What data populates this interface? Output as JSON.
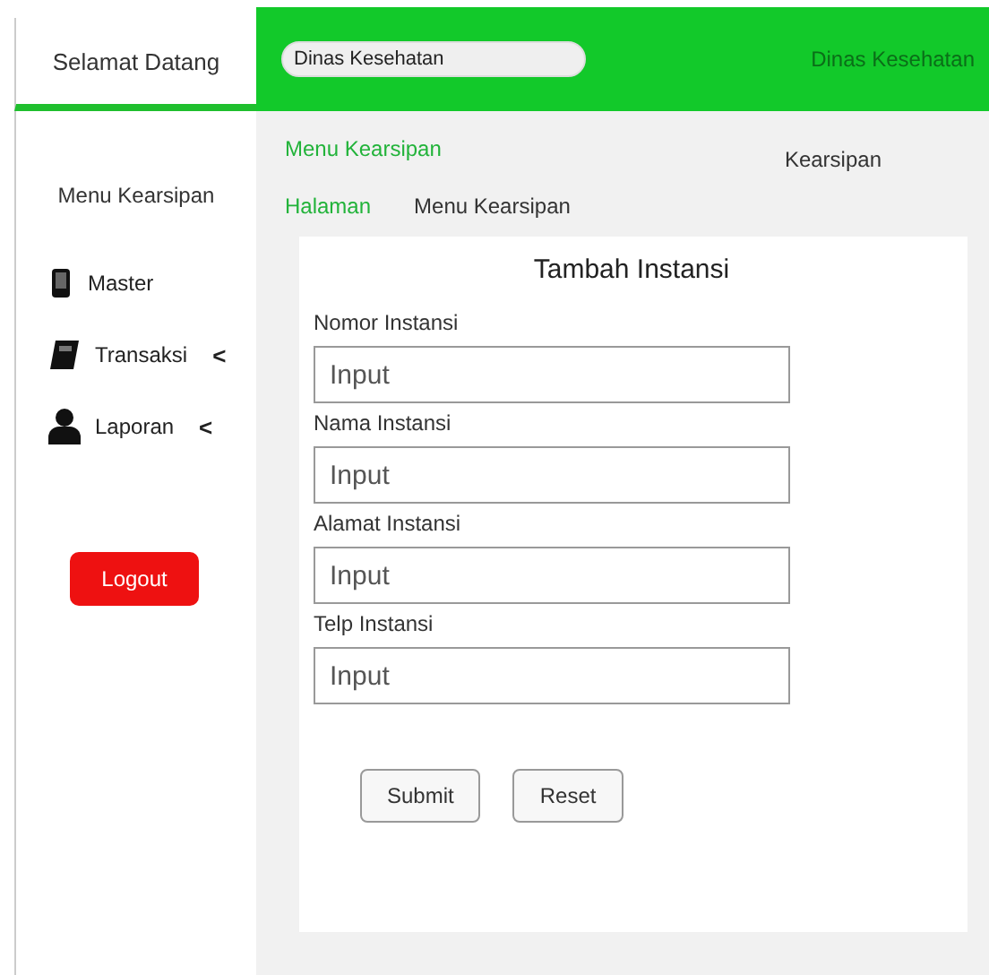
{
  "header": {
    "welcome": "Selamat Datang",
    "search": {
      "value": "Dinas Kesehatan"
    },
    "org": "Dinas Kesehatan"
  },
  "sidebar": {
    "title": "Menu Kearsipan",
    "items": [
      {
        "label": "Master"
      },
      {
        "label": "Transaksi",
        "chevron": "<"
      },
      {
        "label": "Laporan",
        "chevron": "<"
      }
    ],
    "logout": "Logout"
  },
  "page": {
    "heading": "Menu Kearsipan",
    "section": "Kearsipan",
    "breadcrumb": [
      "Halaman",
      "Menu Kearsipan"
    ]
  },
  "form": {
    "title": "Tambah Instansi",
    "fields": [
      {
        "label": "Nomor Instansi",
        "placeholder": "Input"
      },
      {
        "label": "Nama Instansi",
        "placeholder": "Input"
      },
      {
        "label": "Alamat Instansi",
        "placeholder": "Input"
      },
      {
        "label": "Telp Instansi",
        "placeholder": "Input"
      }
    ],
    "buttons": [
      "Submit",
      "Reset"
    ]
  }
}
